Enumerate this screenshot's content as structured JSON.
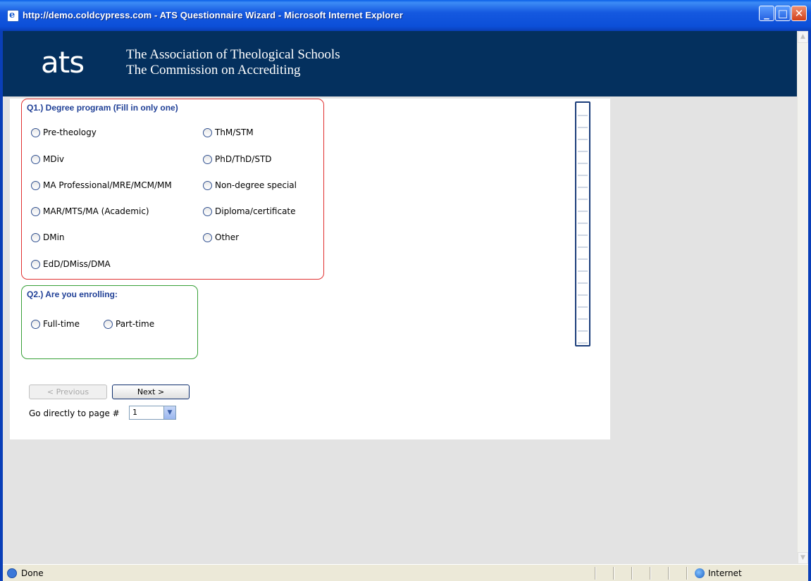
{
  "window": {
    "title": "http://demo.coldcypress.com - ATS Questionnaire Wizard - Microsoft Internet Explorer",
    "app_icon": "ie-document-icon",
    "controls": [
      "minimize-icon",
      "maximize-icon",
      "close-icon"
    ]
  },
  "banner": {
    "logo_text": "ats",
    "line1": "The Association of Theological Schools",
    "line2": "The Commission on Accrediting",
    "background": "#04305e"
  },
  "q1": {
    "title": "Q1.) Degree program (Fill in only one)",
    "border_color": "#e03030",
    "options": [
      "Pre-theology",
      "MDiv",
      "MA Professional/MRE/MCM/MM",
      "MAR/MTS/MA (Academic)",
      "DMin",
      "EdD/DMiss/DMA",
      "ThM/STM",
      "PhD/ThD/STD",
      "Non-degree special",
      "Diploma/certificate",
      "Other"
    ]
  },
  "q2": {
    "title": "Q2.) Are you enrolling:",
    "border_color": "#37a037",
    "options": [
      "Full-time",
      "Part-time"
    ]
  },
  "nav": {
    "prev_label": "< Previous",
    "next_label": "Next >",
    "goto_label": "Go directly to page #",
    "goto_value": "1"
  },
  "status": {
    "text": "Done",
    "zone": "Internet"
  }
}
